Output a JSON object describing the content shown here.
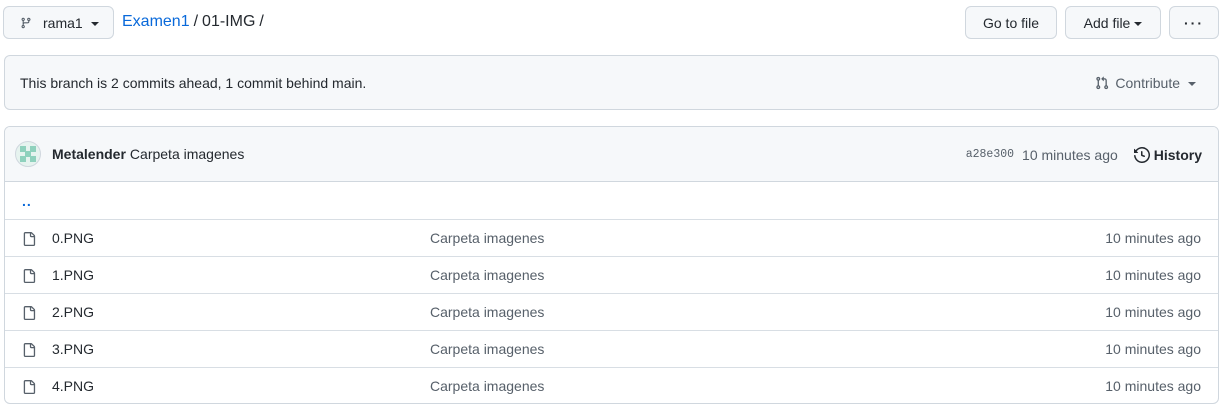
{
  "toolbar": {
    "branch": "rama1",
    "breadcrumb": {
      "repo": "Examen1",
      "sep1": "/",
      "folder": "01-IMG",
      "sep2": "/"
    },
    "go_to_file": "Go to file",
    "add_file": "Add file",
    "more": "···"
  },
  "branch_info": {
    "text": "This branch is 2 commits ahead, 1 commit behind main.",
    "contribute": "Contribute"
  },
  "latest_commit": {
    "author": "Metalender",
    "message": "Carpeta imagenes",
    "sha": "a28e300",
    "time": "10 minutes ago",
    "history": "History"
  },
  "parent_dir": "..",
  "files": [
    {
      "name": "0.PNG",
      "message": "Carpeta imagenes",
      "age": "10 minutes ago"
    },
    {
      "name": "1.PNG",
      "message": "Carpeta imagenes",
      "age": "10 minutes ago"
    },
    {
      "name": "2.PNG",
      "message": "Carpeta imagenes",
      "age": "10 minutes ago"
    },
    {
      "name": "3.PNG",
      "message": "Carpeta imagenes",
      "age": "10 minutes ago"
    },
    {
      "name": "4.PNG",
      "message": "Carpeta imagenes",
      "age": "10 minutes ago"
    }
  ],
  "icons": {
    "branch": "git-branch-icon",
    "file": "file-icon",
    "history": "history-icon",
    "contribute": "pull-request-icon"
  },
  "colors": {
    "link": "#0969da",
    "muted": "#57606a",
    "border": "#d0d7de",
    "header_bg": "#f6f8fa"
  }
}
